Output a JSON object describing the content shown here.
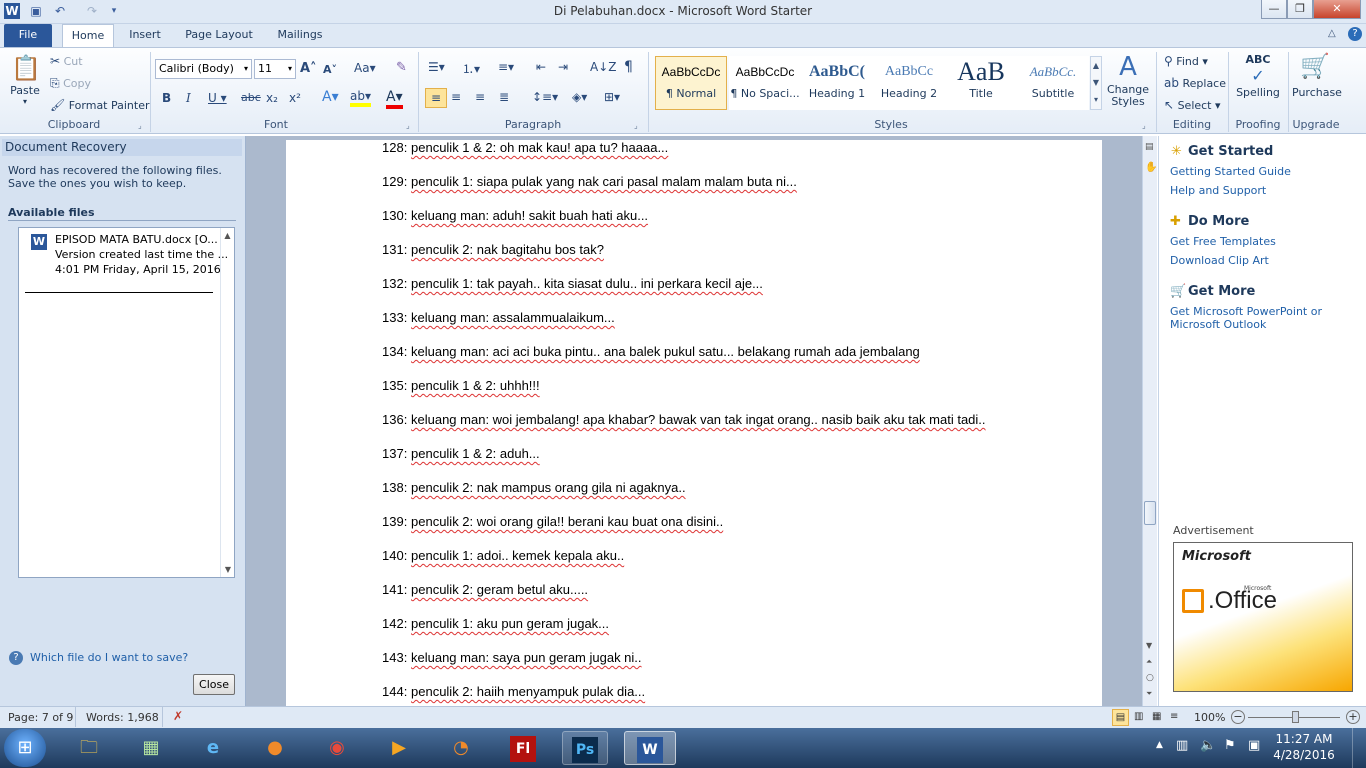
{
  "window": {
    "title": "Di Pelabuhan.docx - Microsoft Word Starter"
  },
  "tabs": [
    {
      "label": "File"
    },
    {
      "label": "Home"
    },
    {
      "label": "Insert"
    },
    {
      "label": "Page Layout"
    },
    {
      "label": "Mailings"
    }
  ],
  "clipboard": {
    "paste": "Paste",
    "cut": "Cut",
    "copy": "Copy",
    "format_painter": "Format Painter",
    "group": "Clipboard"
  },
  "font": {
    "name": "Calibri (Body)",
    "size": "11",
    "group": "Font"
  },
  "paragraph": {
    "group": "Paragraph"
  },
  "styles": {
    "group": "Styles",
    "items": [
      {
        "preview": "AaBbCcDc",
        "name": "¶ Normal"
      },
      {
        "preview": "AaBbCcDc",
        "name": "¶ No Spaci..."
      },
      {
        "preview": "AaBbC(",
        "name": "Heading 1"
      },
      {
        "preview": "AaBbCc",
        "name": "Heading 2"
      },
      {
        "preview": "AaB",
        "name": "Title"
      },
      {
        "preview": "AaBbCc.",
        "name": "Subtitle"
      }
    ],
    "change_styles": "Change Styles"
  },
  "editing": {
    "find": "Find",
    "replace": "Replace",
    "select": "Select",
    "group": "Editing"
  },
  "proofing": {
    "spelling": "Spelling",
    "group": "Proofing"
  },
  "upgrade": {
    "purchase": "Purchase",
    "group": "Upgrade"
  },
  "recovery": {
    "title": "Document Recovery",
    "message": "Word has recovered the following files.  Save the ones you wish to keep.",
    "available": "Available files",
    "file": {
      "name": "EPISOD MATA BATU.docx  [O...",
      "version": "Version created last time the ...",
      "time": "4:01 PM Friday, April 15, 2016"
    },
    "help": "Which file do I want to save?",
    "close": "Close"
  },
  "document_lines": [
    {
      "num": "128:",
      "text": "penculik 1 & 2:  oh mak kau! apa tu? haaaa..."
    },
    {
      "num": "129:",
      "text": "penculik 1: siapa pulak yang nak cari pasal malam malam buta ni..."
    },
    {
      "num": "130:",
      "text": "keluang man: aduh! sakit buah hati aku..."
    },
    {
      "num": "131:",
      "text": "penculik 2: nak bagitahu bos tak?"
    },
    {
      "num": "132:",
      "text": "penculik 1: tak payah.. kita siasat dulu.. ini perkara kecil aje..."
    },
    {
      "num": "133:",
      "text": "keluang man: assalammualaikum..."
    },
    {
      "num": "134:",
      "text": "keluang man: aci aci buka pintu.. ana balek pukul satu... belakang rumah ada jembalang"
    },
    {
      "num": "135:",
      "text": "penculik 1 & 2:  uhhh!!!"
    },
    {
      "num": "136:",
      "text": "keluang man: woi jembalang! apa khabar? bawak van tak ingat orang.. nasib baik aku tak mati tadi.."
    },
    {
      "num": "137:",
      "text": "penculik 1 & 2:  aduh..."
    },
    {
      "num": "138:",
      "text": "penculik 2: nak mampus orang gila ni agaknya.."
    },
    {
      "num": "139:",
      "text": "penculik 2: woi orang gila!! berani kau buat ona disini.."
    },
    {
      "num": "140:",
      "text": "penculik 1: adoi.. kemek kepala aku.."
    },
    {
      "num": "141:",
      "text": "penculik 2: geram betul aku....."
    },
    {
      "num": "142:",
      "text": "penculik 1: aku pun geram jugak..."
    },
    {
      "num": "143:",
      "text": "keluang man: saya pun geram jugak ni.."
    },
    {
      "num": "144:",
      "text": "penculik 2: haiih menyampuk pulak dia..."
    }
  ],
  "right_pane": {
    "get_started": "Get Started",
    "getting_started_guide": "Getting Started Guide",
    "help_support": "Help and Support",
    "do_more": "Do More",
    "free_templates": "Get Free Templates",
    "clip_art": "Download Clip Art",
    "get_more": "Get More",
    "get_more_link": "Get Microsoft PowerPoint or Microsoft Outlook",
    "advertisement": "Advertisement",
    "ad_brand": "Microsoft",
    "ad_small": "Microsoft",
    "ad_product": "Office"
  },
  "status": {
    "page": "Page: 7 of 9",
    "words": "Words: 1,968",
    "zoom": "100%"
  },
  "clock": {
    "time": "11:27 AM",
    "date": "4/28/2016"
  },
  "colors": {
    "accent": "#2b579a",
    "ribbon": "#dfe9f5",
    "link": "#1f5fa8"
  }
}
